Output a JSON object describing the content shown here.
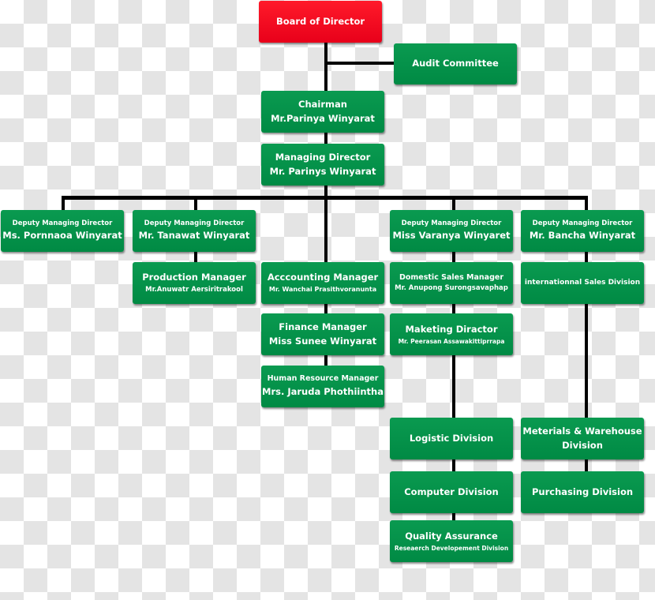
{
  "colors": {
    "box": "#008c46",
    "board": "#f0001a",
    "connector": "#000000"
  },
  "board": {
    "title": "Board of Director"
  },
  "audit": {
    "title": "Audit Committee"
  },
  "chairman": {
    "title": "Chairman",
    "name": "Mr.Parinya Winyarat"
  },
  "managing_director": {
    "title": "Managing Director",
    "name": "Mr. Parinys Winyarat"
  },
  "deputies": [
    {
      "title": "Deputy Managing Director",
      "name": "Ms. Pornnaoa Winyarat"
    },
    {
      "title": "Deputy Managing Director",
      "name": "Mr. Tanawat Winyarat"
    },
    {
      "title": "Deputy Managing Director",
      "name": "Miss Varanya Winyaret"
    },
    {
      "title": "Deputy Managing Director",
      "name": "Mr. Bancha Winyarat"
    }
  ],
  "production": {
    "title": "Production Manager",
    "name": "Mr.Anuwatr Aersiritrakool"
  },
  "accounting": {
    "title": "Acccounting Manager",
    "name": "Mr. Wanchai Prasithvoranunta"
  },
  "finance": {
    "title": "Finance Manager",
    "name": "Miss Sunee Winyarat"
  },
  "hr": {
    "title": "Human Resource Manager",
    "name": "Mrs. Jaruda Phothiintha"
  },
  "domestic_sales": {
    "title": "Domestic Sales Manager",
    "name": "Mr. Anupong Surongsavaphap"
  },
  "marketing": {
    "title": "Maketing Diractor",
    "name": "Mr. Peerasan Assawakittiprrapa"
  },
  "international": {
    "title": "internationnal Sales Division"
  },
  "logistic": {
    "title": "Logistic Division"
  },
  "computer": {
    "title": "Computer Division"
  },
  "qa": {
    "title": "Quality Assurance",
    "subtitle": "Reseaerch Developement Division"
  },
  "materials": {
    "title": "Meterials & Warehouse",
    "title2": "Division"
  },
  "purchasing": {
    "title": "Purchasing Division"
  }
}
